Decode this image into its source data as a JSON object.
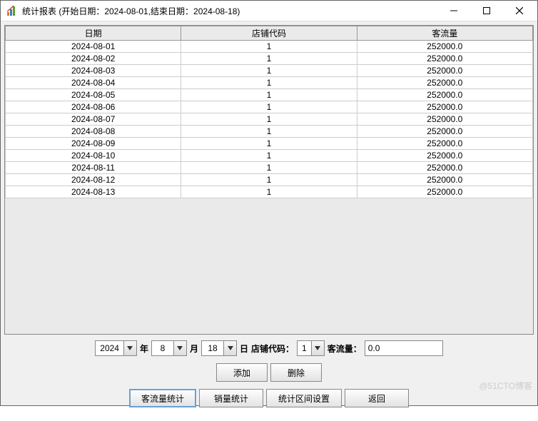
{
  "window": {
    "title": "统计报表 (开始日期：2024-08-01,结束日期：2024-08-18)"
  },
  "table": {
    "headers": {
      "date": "日期",
      "store": "店铺代码",
      "traffic": "客流量"
    },
    "rows": [
      {
        "date": "2024-08-01",
        "store": "1",
        "traffic": "252000.0"
      },
      {
        "date": "2024-08-02",
        "store": "1",
        "traffic": "252000.0"
      },
      {
        "date": "2024-08-03",
        "store": "1",
        "traffic": "252000.0"
      },
      {
        "date": "2024-08-04",
        "store": "1",
        "traffic": "252000.0"
      },
      {
        "date": "2024-08-05",
        "store": "1",
        "traffic": "252000.0"
      },
      {
        "date": "2024-08-06",
        "store": "1",
        "traffic": "252000.0"
      },
      {
        "date": "2024-08-07",
        "store": "1",
        "traffic": "252000.0"
      },
      {
        "date": "2024-08-08",
        "store": "1",
        "traffic": "252000.0"
      },
      {
        "date": "2024-08-09",
        "store": "1",
        "traffic": "252000.0"
      },
      {
        "date": "2024-08-10",
        "store": "1",
        "traffic": "252000.0"
      },
      {
        "date": "2024-08-11",
        "store": "1",
        "traffic": "252000.0"
      },
      {
        "date": "2024-08-12",
        "store": "1",
        "traffic": "252000.0"
      },
      {
        "date": "2024-08-13",
        "store": "1",
        "traffic": "252000.0"
      }
    ]
  },
  "form": {
    "year_value": "2024",
    "year_label": "年",
    "month_value": "8",
    "month_label": "月",
    "day_value": "18",
    "day_label": "日",
    "store_label": "店铺代码：",
    "store_value": "1",
    "traffic_label": "客流量：",
    "traffic_value": "0.0"
  },
  "buttons": {
    "add": "添加",
    "delete": "删除",
    "traffic_stats": "客流量统计",
    "sales_stats": "销量统计",
    "interval_settings": "统计区间设置",
    "back": "返回"
  },
  "watermark": "@51CTO博客"
}
